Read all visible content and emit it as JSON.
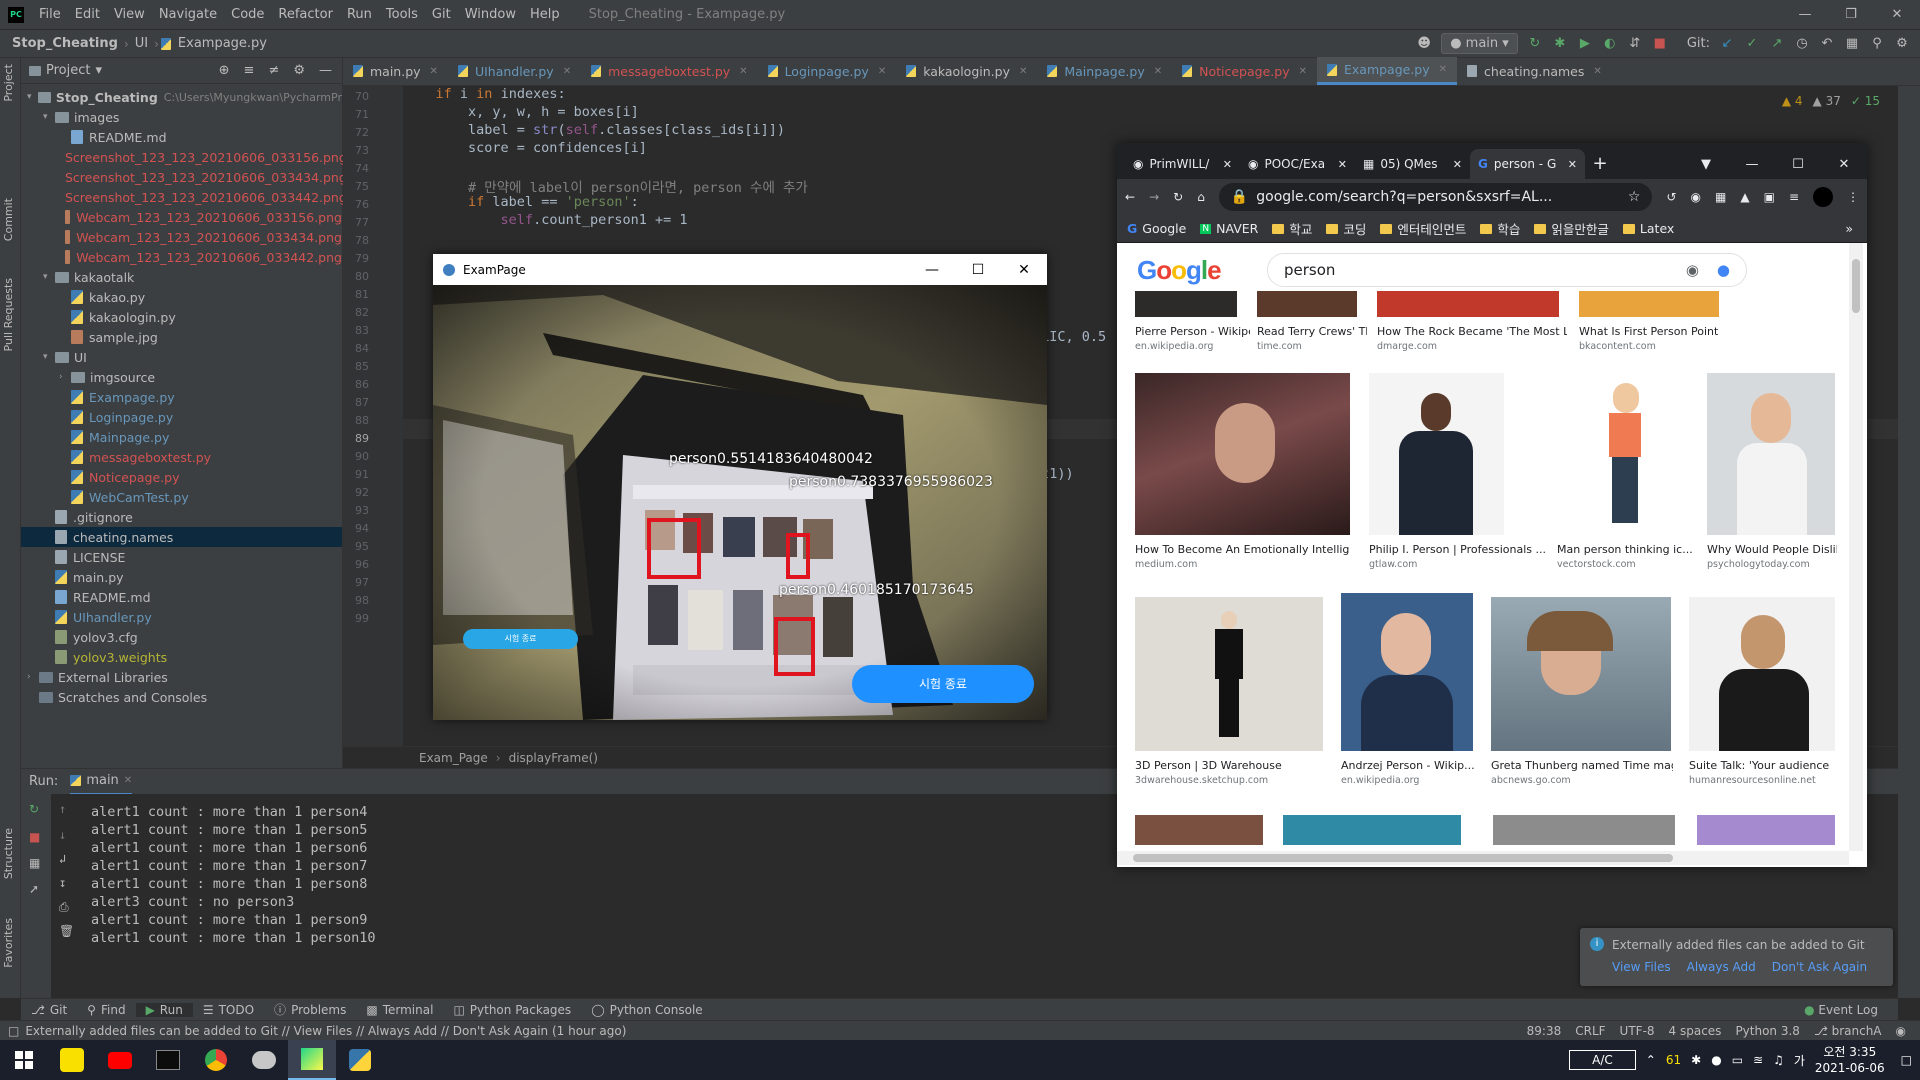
{
  "menubar": {
    "logo": "PC",
    "items": [
      "File",
      "Edit",
      "View",
      "Navigate",
      "Code",
      "Refactor",
      "Run",
      "Tools",
      "Git",
      "Window",
      "Help"
    ],
    "window_title": "Stop_Cheating - Exampage.py"
  },
  "navbar": {
    "crumbs": [
      "Stop_Cheating",
      "UI",
      "Exampage.py"
    ],
    "branch": "main",
    "git_label": "Git:"
  },
  "left_strip": [
    "Project",
    "Commit",
    "Pull Requests",
    "Structure",
    "Favorites"
  ],
  "project": {
    "header": "Project",
    "tree": [
      {
        "indent": 0,
        "arrow": "▾",
        "type": "folder",
        "name": "Stop_Cheating",
        "extra": "C:\\Users\\Myungkwan\\PycharmPr",
        "bold": true
      },
      {
        "indent": 1,
        "arrow": "▾",
        "type": "folder",
        "name": "images"
      },
      {
        "indent": 2,
        "arrow": "",
        "type": "md",
        "name": "README.md"
      },
      {
        "indent": 2,
        "arrow": "",
        "type": "img",
        "name": "Screenshot_123_123_20210606_033156.png",
        "cls": "red"
      },
      {
        "indent": 2,
        "arrow": "",
        "type": "img",
        "name": "Screenshot_123_123_20210606_033434.png",
        "cls": "red"
      },
      {
        "indent": 2,
        "arrow": "",
        "type": "img",
        "name": "Screenshot_123_123_20210606_033442.png",
        "cls": "red"
      },
      {
        "indent": 2,
        "arrow": "",
        "type": "img",
        "name": "Webcam_123_123_20210606_033156.png",
        "cls": "red"
      },
      {
        "indent": 2,
        "arrow": "",
        "type": "img",
        "name": "Webcam_123_123_20210606_033434.png",
        "cls": "red"
      },
      {
        "indent": 2,
        "arrow": "",
        "type": "img",
        "name": "Webcam_123_123_20210606_033442.png",
        "cls": "red"
      },
      {
        "indent": 1,
        "arrow": "▾",
        "type": "folder",
        "name": "kakaotalk"
      },
      {
        "indent": 2,
        "arrow": "",
        "type": "py",
        "name": "kakao.py"
      },
      {
        "indent": 2,
        "arrow": "",
        "type": "py",
        "name": "kakaologin.py"
      },
      {
        "indent": 2,
        "arrow": "",
        "type": "img",
        "name": "sample.jpg"
      },
      {
        "indent": 1,
        "arrow": "▾",
        "type": "folder",
        "name": "UI"
      },
      {
        "indent": 2,
        "arrow": "›",
        "type": "folder",
        "name": "imgsource"
      },
      {
        "indent": 2,
        "arrow": "",
        "type": "py",
        "name": "Exampage.py",
        "cls": "blue"
      },
      {
        "indent": 2,
        "arrow": "",
        "type": "py",
        "name": "Loginpage.py",
        "cls": "blue"
      },
      {
        "indent": 2,
        "arrow": "",
        "type": "py",
        "name": "Mainpage.py",
        "cls": "blue"
      },
      {
        "indent": 2,
        "arrow": "",
        "type": "py",
        "name": "messageboxtest.py",
        "cls": "red"
      },
      {
        "indent": 2,
        "arrow": "",
        "type": "py",
        "name": "Noticepage.py",
        "cls": "red"
      },
      {
        "indent": 2,
        "arrow": "",
        "type": "py",
        "name": "WebCamTest.py",
        "cls": "blue"
      },
      {
        "indent": 1,
        "arrow": "",
        "type": "txt",
        "name": ".gitignore"
      },
      {
        "indent": 1,
        "arrow": "",
        "type": "txt",
        "name": "cheating.names",
        "sel": true
      },
      {
        "indent": 1,
        "arrow": "",
        "type": "txt",
        "name": "LICENSE"
      },
      {
        "indent": 1,
        "arrow": "",
        "type": "py",
        "name": "main.py"
      },
      {
        "indent": 1,
        "arrow": "",
        "type": "md",
        "name": "README.md"
      },
      {
        "indent": 1,
        "arrow": "",
        "type": "py",
        "name": "UIhandler.py",
        "cls": "blue"
      },
      {
        "indent": 1,
        "arrow": "",
        "type": "cfg",
        "name": "yolov3.cfg"
      },
      {
        "indent": 1,
        "arrow": "",
        "type": "cfg",
        "name": "yolov3.weights",
        "cls": "yel"
      },
      {
        "indent": 0,
        "arrow": "›",
        "type": "lib",
        "name": "External Libraries"
      },
      {
        "indent": 0,
        "arrow": "",
        "type": "lib",
        "name": "Scratches and Consoles"
      }
    ]
  },
  "editor_tabs": [
    {
      "name": "main.py",
      "cls": ""
    },
    {
      "name": "UIhandler.py",
      "cls": "blue"
    },
    {
      "name": "messageboxtest.py",
      "cls": "red"
    },
    {
      "name": "Loginpage.py",
      "cls": "blue"
    },
    {
      "name": "kakaologin.py",
      "cls": ""
    },
    {
      "name": "Mainpage.py",
      "cls": "blue"
    },
    {
      "name": "Noticepage.py",
      "cls": "red"
    },
    {
      "name": "Exampage.py",
      "cls": "blue",
      "active": true
    },
    {
      "name": "cheating.names",
      "cls": ""
    }
  ],
  "inspections": {
    "warnings": "4",
    "weak": "37",
    "ok": "15"
  },
  "line_numbers": [
    "70",
    "71",
    "72",
    "73",
    "74",
    "75",
    "76",
    "77",
    "78",
    "79",
    "80",
    "81",
    "82",
    "83",
    "84",
    "85",
    "86",
    "87",
    "88",
    "89",
    "90",
    "91",
    "92",
    "93",
    "94",
    "95",
    "96",
    "97",
    "98",
    "99"
  ],
  "code_fragments": {
    "line84_tail": "ALIC, 0.5",
    "line91_tail": "rt1))"
  },
  "editor_breadcrumb": [
    "Exam_Page",
    "displayFrame()"
  ],
  "run": {
    "label": "Run:",
    "config": "main",
    "output": [
      "alert1 count : more than 1 person4",
      "alert1 count : more than 1 person5",
      "alert1 count : more than 1 person6",
      "alert1 count : more than 1 person7",
      "alert1 count : more than 1 person8",
      "alert3 count : no person3",
      "alert1 count : more than 1 person9",
      "alert1 count : more than 1 person10"
    ]
  },
  "bottom_tabs": [
    "Git",
    "Find",
    "Run",
    "TODO",
    "Problems",
    "Terminal",
    "Python Packages",
    "Python Console"
  ],
  "event_log": "Event Log",
  "status": {
    "message": "Externally added files can be added to Git // View Files // Always Add // Don't Ask Again (1 hour ago)",
    "position": "89:38",
    "line_sep": "CRLF",
    "encoding": "UTF-8",
    "indent": "4 spaces",
    "interpreter": "Python 3.8",
    "branch": "branchA"
  },
  "notification": {
    "message": "Externally added files can be added to Git",
    "actions": [
      "View Files",
      "Always Add",
      "Don't Ask Again"
    ]
  },
  "exam_window": {
    "title": "ExamPage",
    "detections": [
      "person0.5514183640480042",
      "person0.7383376955986023",
      "person0.460185170173645"
    ],
    "end_button": "시험 종료",
    "small_button": "시험 종료"
  },
  "chrome": {
    "tabs": [
      {
        "title": "PrimWILL/"
      },
      {
        "title": "POOC/Exa"
      },
      {
        "title": "05) QMes"
      },
      {
        "title": "person - G",
        "active": true
      }
    ],
    "url": "google.com/search?q=person&sxsrf=AL...",
    "bookmarks": [
      {
        "label": "Google",
        "kind": "g"
      },
      {
        "label": "NAVER",
        "kind": "n"
      },
      {
        "label": "학교",
        "kind": "f"
      },
      {
        "label": "코딩",
        "kind": "f"
      },
      {
        "label": "엔터테인먼트",
        "kind": "f"
      },
      {
        "label": "학습",
        "kind": "f"
      },
      {
        "label": "읽을만한글",
        "kind": "f"
      },
      {
        "label": "Latex",
        "kind": "f"
      }
    ],
    "query": "person",
    "row1": [
      {
        "cap": "Pierre Person - Wikiped...",
        "src": "en.wikipedia.org"
      },
      {
        "cap": "Read Terry Crews' TIM...",
        "src": "time.com"
      },
      {
        "cap": "How The Rock Became 'The Most Likeable ...",
        "src": "dmarge.com"
      },
      {
        "cap": "What Is First Person Point of View",
        "src": "bkacontent.com"
      }
    ],
    "row2": [
      {
        "cap": "How To Become An Emotionally Intellige...",
        "src": "medium.com"
      },
      {
        "cap": "Philip I. Person | Professionals ...",
        "src": "gtlaw.com"
      },
      {
        "cap": "Man person thinking ic...",
        "src": "vectorstock.com"
      },
      {
        "cap": "Why Would People Dislike a",
        "src": "psychologytoday.com"
      }
    ],
    "row3": [
      {
        "cap": "3D Person | 3D Warehouse",
        "src": "3dwarehouse.sketchup.com"
      },
      {
        "cap": "Andrzej Person - Wikip...",
        "src": "en.wikipedia.org"
      },
      {
        "cap": "Greta Thunberg named Time magazine's...",
        "src": "abcnews.go.com"
      },
      {
        "cap": "Suite Talk: 'Your audience",
        "src": "humanresourcesonline.net"
      }
    ]
  },
  "tray": {
    "ac": "A/C",
    "temp": "61",
    "time": "오전 3:35",
    "date": "2021-06-06"
  },
  "colors": {
    "ide_bg": "#2b2b2b",
    "panel": "#3c3f41",
    "detection_box": "#e0141e",
    "exam_button": "#1e90ff"
  }
}
